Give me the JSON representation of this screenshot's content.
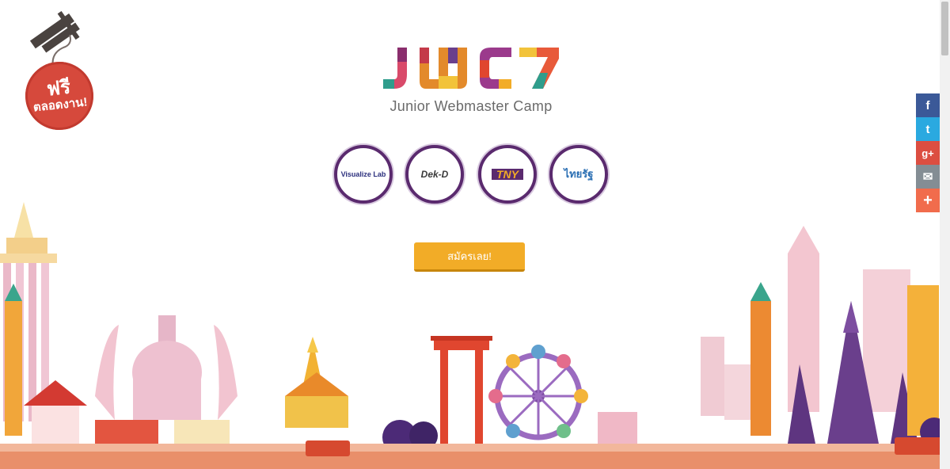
{
  "badge": {
    "line1": "ฟรี",
    "line2": "ตลอดงาน!"
  },
  "logo": {
    "wordmark": "JWC7",
    "subtitle": "Junior Webmaster Camp"
  },
  "sponsors": [
    {
      "name": "Visualize Lab"
    },
    {
      "name": "Dek-D"
    },
    {
      "name": "TNY"
    },
    {
      "name": "ไทยรัฐ"
    }
  ],
  "cta": {
    "label": "สมัครเลย!"
  },
  "share": [
    {
      "network": "facebook",
      "glyph": "f",
      "color": "#3b5998"
    },
    {
      "network": "twitter",
      "glyph": "t",
      "color": "#2aa9e0"
    },
    {
      "network": "google-plus",
      "glyph": "g+",
      "color": "#dc4e41"
    },
    {
      "network": "email",
      "glyph": "✉",
      "color": "#848d94"
    },
    {
      "network": "more",
      "glyph": "+",
      "color": "#f16c4c"
    }
  ],
  "colors": {
    "accent": "#f2ac27",
    "sponsor_ring": "#5a2a6e"
  }
}
